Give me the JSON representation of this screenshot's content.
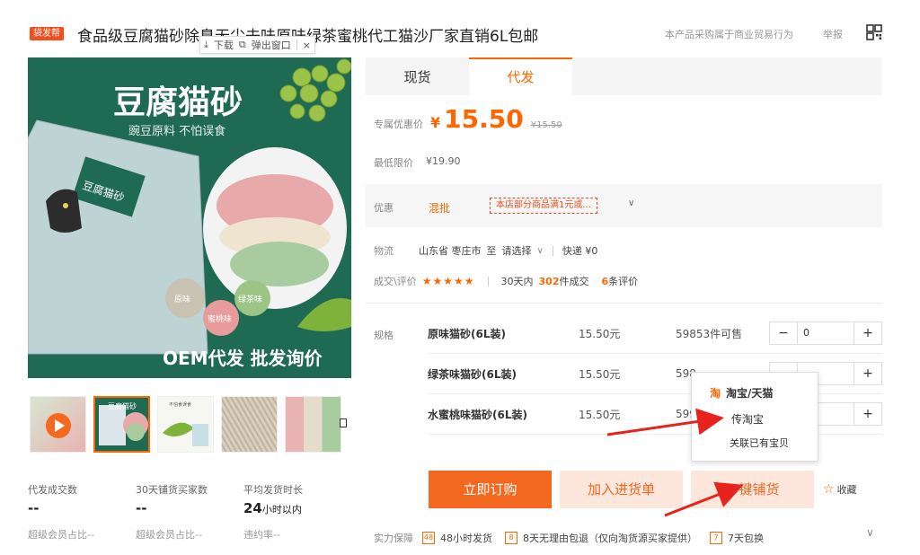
{
  "header": {
    "badge": "袋发帮",
    "title": "食品级豆腐猫砂除臭无尘去味原味绿茶蜜桃代工猫沙厂家直销6L包邮",
    "notice": "本产品采购属于商业贸易行为",
    "report": "举报"
  },
  "float_toolbar": {
    "download": "下载",
    "popout": "弹出窗口",
    "close": "×"
  },
  "image": {
    "headline": "豆腐猫砂",
    "sub": "豌豆原料 不怕误食",
    "brand_tag": "豆腐猫砂",
    "bottom": "OEM代发 批发询价",
    "flavor_1": "原味",
    "flavor_2": "蜜桃味",
    "flavor_3": "绿茶味"
  },
  "thumbs": {
    "t1_text": "豆腐猫砂",
    "t2_text": "不怕食误食"
  },
  "stats": [
    {
      "label": "代发成交数",
      "value": "--",
      "unit": "",
      "sub": "超级会员占比--"
    },
    {
      "label": "30天铺货买家数",
      "value": "--",
      "unit": "",
      "sub": "超级会员占比--"
    },
    {
      "label": "平均发货时长",
      "value": "24",
      "unit": "小时以内",
      "sub": "违约率--"
    }
  ],
  "tabs": [
    "现货",
    "代发"
  ],
  "price": {
    "label": "专属优惠价",
    "currency": "¥",
    "value": "15.50",
    "original": "¥15.50"
  },
  "min_price": {
    "label": "最低限价",
    "value": "¥19.90"
  },
  "promo": {
    "label": "优惠",
    "mix": "混批",
    "coupon": "本店部分商品满1元或...",
    "chevron": "∨"
  },
  "shipping": {
    "label": "物流",
    "from": "山东省 枣庄市",
    "to_word": "至",
    "to": "请选择",
    "chevron": "∨",
    "express": "快递 ¥0"
  },
  "deals": {
    "label": "成交\\评价",
    "stars": "★★★★★",
    "prefix": "30天内",
    "count": "302",
    "count_unit": "件成交",
    "reviews": "6",
    "reviews_unit": "条评价"
  },
  "spec": {
    "label": "规格",
    "rows": [
      {
        "name": "原味猫砂(6L装)",
        "price": "15.50元",
        "stock": "59853件可售",
        "qty": "0"
      },
      {
        "name": "绿茶味猫砂(6L装)",
        "price": "15.50元",
        "stock": "598",
        "qty": ""
      },
      {
        "name": "水蜜桃味猫砂(6L装)",
        "price": "15.50元",
        "stock": "599",
        "qty": ""
      }
    ],
    "minus": "−",
    "plus": "+"
  },
  "popup": {
    "logo": "淘",
    "title": "淘宝/天猫",
    "item1": "传淘宝",
    "item2": "关联已有宝贝"
  },
  "actions": {
    "buy": "立即订购",
    "cart": "加入进货单",
    "distribute": "一键铺货",
    "fav_icon": "☆",
    "fav": "收藏"
  },
  "guarantee": {
    "label": "实力保障",
    "g1": "48小时发货",
    "g2": "8天无理由包退（仅向淘货源买家提供）",
    "g3": "7天包换",
    "chevron": "∨"
  },
  "colors": {
    "accent": "#f4681f",
    "accent_light": "#fde7dc",
    "image_bg": "#1f6a52"
  }
}
